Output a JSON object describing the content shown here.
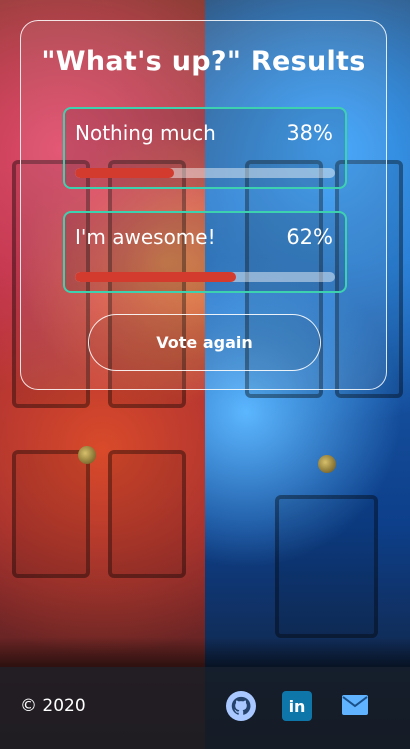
{
  "card": {
    "title": "\"What's up?\" Results",
    "options": [
      {
        "label": "Nothing much",
        "percent_text": "38%",
        "percent": 38
      },
      {
        "label": "I'm awesome!",
        "percent_text": "62%",
        "percent": 62
      }
    ],
    "vote_again_label": "Vote again"
  },
  "footer": {
    "copyright": "© 2020",
    "icons": [
      "github-icon",
      "linkedin-icon",
      "mail-icon"
    ]
  },
  "colors": {
    "option_border": "#3ed1b0",
    "bar_fill": "#d23b2e",
    "footer_bg": "#161c24"
  }
}
